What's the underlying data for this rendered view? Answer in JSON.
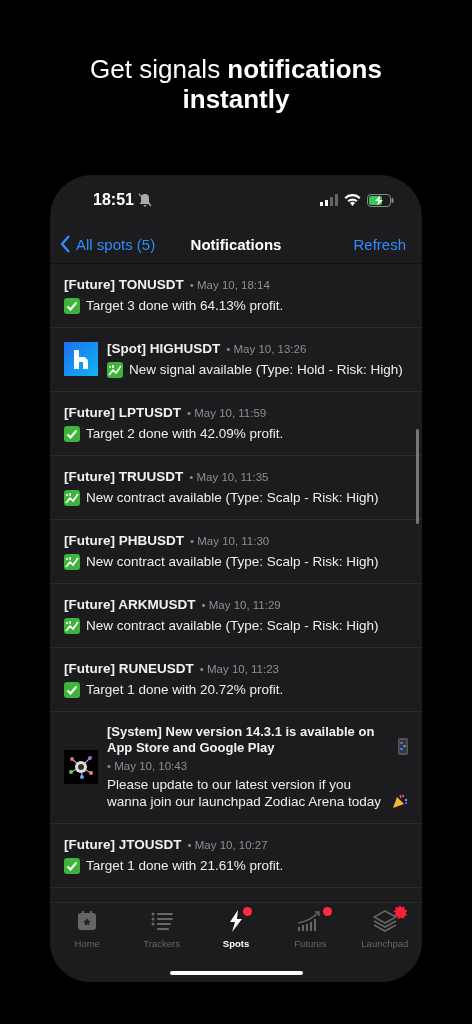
{
  "headline": "Get signals **notifications instantly**",
  "status_bar": {
    "time": "18:51"
  },
  "nav": {
    "back": "All spots (5)",
    "title": "Notifications",
    "action": "Refresh"
  },
  "notifications": [
    {
      "kind": "target",
      "has_avatar": false,
      "title": "[Future] TONUSDT",
      "date": "• May 10, 18:14",
      "body": "Target 3 done with 64.13% profit."
    },
    {
      "kind": "signal",
      "has_avatar": true,
      "title": "[Spot] HIGHUSDT",
      "date": "• May 10, 13:26",
      "body": "New signal available (Type: Hold - Risk: High)"
    },
    {
      "kind": "target",
      "has_avatar": false,
      "title": "[Future] LPTUSDT",
      "date": "• May 10, 11:59",
      "body": "Target 2 done with 42.09% profit."
    },
    {
      "kind": "signal",
      "has_avatar": false,
      "title": "[Future] TRUUSDT",
      "date": "• May 10, 11:35",
      "body": "New contract available (Type: Scalp - Risk: High)"
    },
    {
      "kind": "signal",
      "has_avatar": false,
      "title": "[Future] PHBUSDT",
      "date": "• May 10, 11:30",
      "body": "New contract available (Type: Scalp - Risk: High)"
    },
    {
      "kind": "signal",
      "has_avatar": false,
      "title": "[Future] ARKMUSDT",
      "date": "• May 10, 11:29",
      "body": "New contract available (Type: Scalp - Risk: High)"
    },
    {
      "kind": "target",
      "has_avatar": false,
      "title": "[Future] RUNEUSDT",
      "date": "• May 10, 11:23",
      "body": "Target 1 done with 20.72% profit."
    },
    {
      "kind": "system",
      "has_avatar": true,
      "title": "[System] New version 14.3.1 is available on App Store and Google Play",
      "date": "• May 10, 10:43",
      "body": "Please update to our latest version if you wanna join our launchpad Zodiac Arena today"
    },
    {
      "kind": "target",
      "has_avatar": false,
      "title": "[Future] JTOUSDT",
      "date": "• May 10, 10:27",
      "body": "Target 1 done with 21.61% profit."
    }
  ],
  "tabs": [
    {
      "label": "Home",
      "selected": false,
      "kind": "plain"
    },
    {
      "label": "Trackers",
      "selected": false,
      "kind": "plain"
    },
    {
      "label": "Spots",
      "selected": true,
      "kind": "dot"
    },
    {
      "label": "Futures",
      "selected": false,
      "kind": "dot"
    },
    {
      "label": "Launchpad",
      "selected": false,
      "kind": "hot"
    }
  ]
}
